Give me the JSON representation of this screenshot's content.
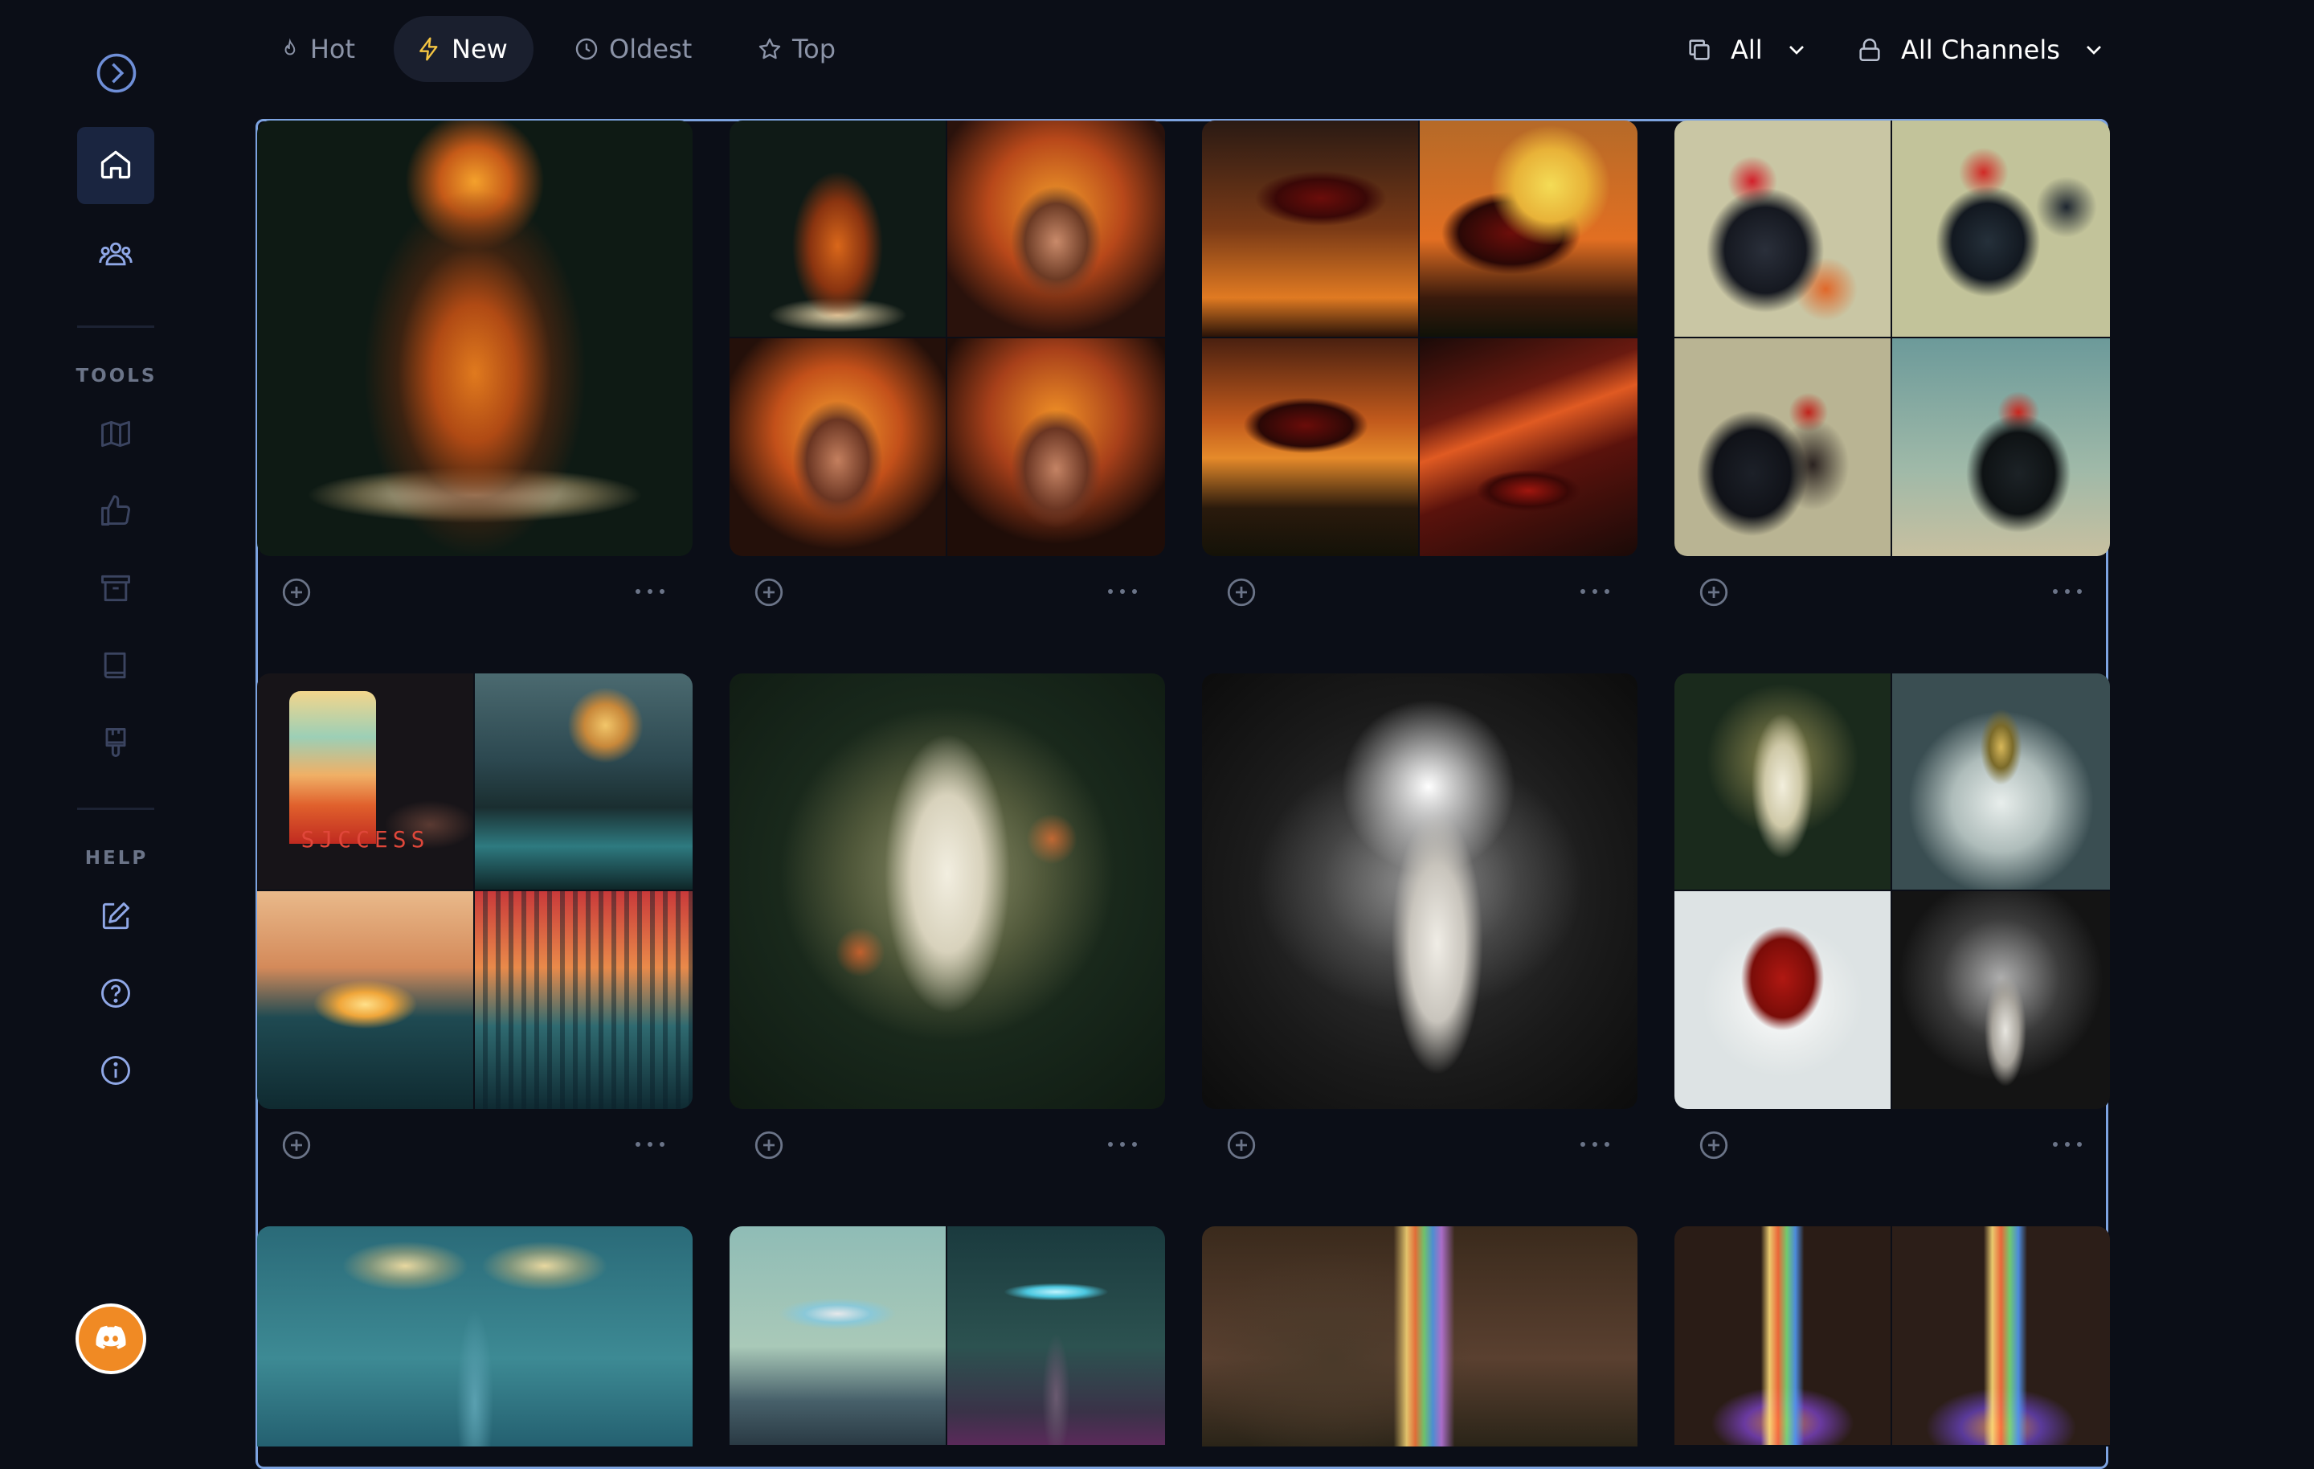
{
  "sidebar": {
    "sections": [
      {
        "label": "TOOLS"
      },
      {
        "label": "HELP"
      }
    ],
    "icons": {
      "toggle": "chevron-right-circle-icon",
      "home": "home-icon",
      "community": "users-icon",
      "tools": [
        "map-icon",
        "thumbs-up-icon",
        "archive-icon",
        "book-icon",
        "paintbrush-icon"
      ],
      "help": [
        "edit-icon",
        "help-circle-icon",
        "info-icon"
      ],
      "discord": "discord-icon"
    }
  },
  "topbar": {
    "sort_tabs": [
      {
        "label": "Hot",
        "icon": "flame-icon",
        "active": false
      },
      {
        "label": "New",
        "icon": "lightning-icon",
        "active": true
      },
      {
        "label": "Oldest",
        "icon": "clock-icon",
        "active": false
      },
      {
        "label": "Top",
        "icon": "star-icon",
        "active": false
      }
    ],
    "filters": [
      {
        "label": "All",
        "icon": "copy-icon"
      },
      {
        "label": "All Channels",
        "icon": "lock-icon"
      }
    ]
  },
  "gallery": {
    "rows": 3,
    "columns": 4,
    "cards": [
      {
        "kind": "single",
        "subject": "fiery tentacle figure"
      },
      {
        "kind": "grid",
        "subject": "fiery medusa portraits"
      },
      {
        "kind": "grid",
        "subject": "red bird at sunset"
      },
      {
        "kind": "grid",
        "subject": "pirate chickens"
      },
      {
        "kind": "grid",
        "subject": "retro sunsets",
        "caption": "SJCCESS"
      },
      {
        "kind": "single",
        "subject": "white robed figure in flowers"
      },
      {
        "kind": "single",
        "subject": "white robed figure in smoke"
      },
      {
        "kind": "grid",
        "subject": "white figures and wings"
      },
      {
        "kind": "single",
        "subject": "winged tower"
      },
      {
        "kind": "grid",
        "subject": "flying cars over city"
      },
      {
        "kind": "single",
        "subject": "rainbow light beam"
      },
      {
        "kind": "grid",
        "subject": "rainbow glass dome"
      }
    ]
  },
  "colors": {
    "background": "#0b0e17",
    "active_tab": "#1a1f2e",
    "selection_border": "#7da3e0",
    "discord_orange": "#f08a24"
  }
}
